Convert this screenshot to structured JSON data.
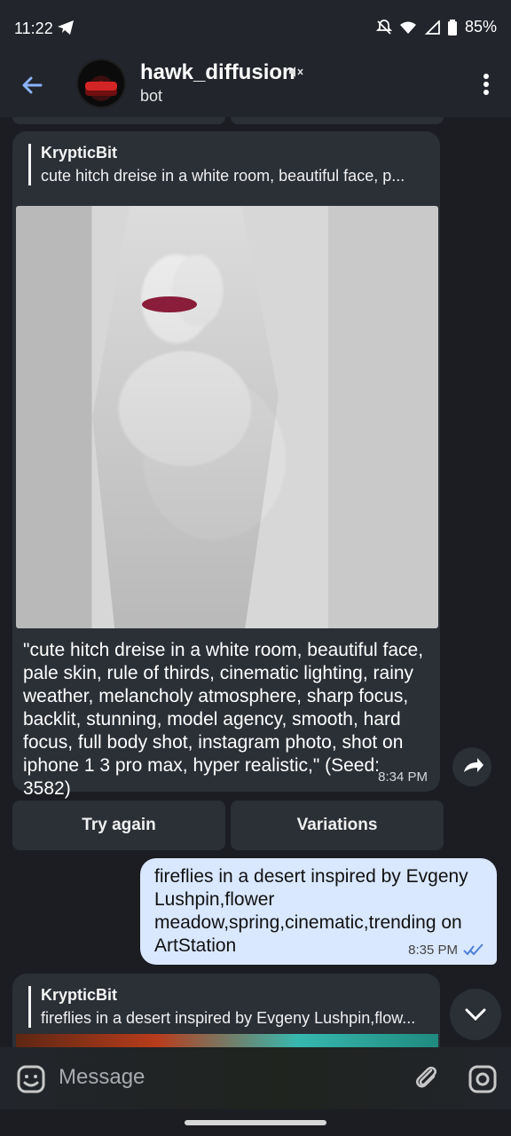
{
  "status": {
    "time": "11:22",
    "battery": "85%"
  },
  "header": {
    "title": "hawk_diffusion",
    "subtitle": "bot"
  },
  "messages": [
    {
      "reply_name": "KrypticBit",
      "reply_text": "cute hitch dreise in a white room, beautiful face, p...",
      "caption": "\"cute hitch dreise in a white room, beautiful face, pale skin, rule of thirds, cinematic lighting, rainy weather, melancholy atmosphere, sharp focus, backlit, stunning, model agency, smooth, hard focus, full body shot, instagram photo, shot on iphone 1 3 pro max, hyper realistic,\" (Seed: 3582)",
      "time": "8:34 PM"
    },
    {
      "text": "fireflies in a desert inspired by Evgeny Lushpin,flower meadow,spring,cinematic,trending on ArtStation",
      "time": "8:35 PM"
    },
    {
      "reply_name": "KrypticBit",
      "reply_text": "fireflies in a desert inspired by Evgeny Lushpin,flow..."
    }
  ],
  "buttons": {
    "try_again": "Try again",
    "variations": "Variations"
  },
  "composer": {
    "placeholder": "Message"
  },
  "icons": [
    "telegram-icon",
    "alarm-off-icon",
    "wifi-icon",
    "signal-icon",
    "battery-icon",
    "back-arrow-icon",
    "mute-icon",
    "more-vert-icon",
    "forward-icon",
    "double-check-icon",
    "chevron-down-icon",
    "emoji-icon",
    "paperclip-icon",
    "camera-icon"
  ],
  "colors": {
    "background": "#1b1d22",
    "bubble_incoming": "#2b2f36",
    "bubble_outgoing": "#d9e7ff",
    "accent": "#8ab4f8"
  }
}
